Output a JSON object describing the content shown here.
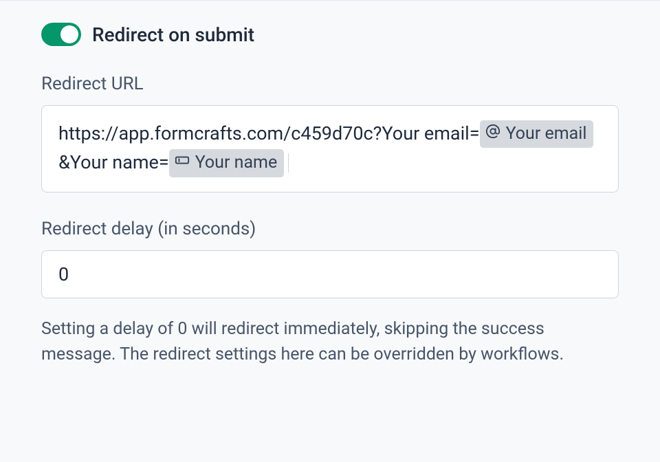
{
  "toggle": {
    "label": "Redirect on submit",
    "on": true
  },
  "redirect_url": {
    "label": "Redirect URL",
    "prefix": "https://app.formcrafts.com/c459d70c?Your email=",
    "chip1": "Your email",
    "mid": "&Your name=",
    "chip2": "Your name"
  },
  "delay": {
    "label": "Redirect delay (in seconds)",
    "value": "0"
  },
  "help": "Setting a delay of 0 will redirect immediately, skipping the success message. The redirect settings here can be overridden by workflows."
}
